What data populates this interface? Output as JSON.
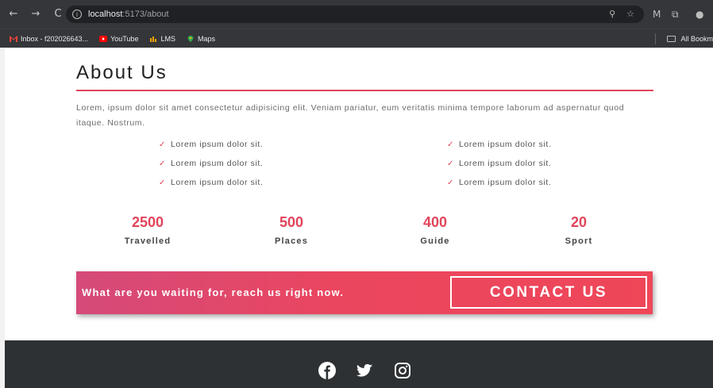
{
  "browser": {
    "nav_back": "←",
    "nav_forward": "→",
    "nav_reload": "C",
    "url_host": "localhost",
    "url_path": ":5173/about",
    "bookmarks": [
      {
        "label": "Inbox - f202026643...",
        "icon": "gmail-icon"
      },
      {
        "label": "YouTube",
        "icon": "youtube-icon"
      },
      {
        "label": "LMS",
        "icon": "lms-icon"
      },
      {
        "label": "Maps",
        "icon": "maps-icon"
      }
    ],
    "all_bookmarks": "All Bookm"
  },
  "about": {
    "title": "About Us",
    "intro": "Lorem, ipsum dolor sit amet consectetur adipisicing elit. Veniam pariatur, eum veritatis minima tempore laborum ad aspernatur quod itaque. Nostrum.",
    "check_left": [
      "Lorem ipsum dolor sit.",
      "Lorem ipsum dolor sit.",
      "Lorem ipsum dolor sit."
    ],
    "check_right": [
      "Lorem ipsum dolor sit.",
      "Lorem ipsum dolor sit.",
      "Lorem ipsum dolor sit."
    ],
    "check_glyph": "✓"
  },
  "stats": [
    {
      "value": "2500",
      "label": "Travelled"
    },
    {
      "value": "500",
      "label": "Places"
    },
    {
      "value": "400",
      "label": "Guide"
    },
    {
      "value": "20",
      "label": "Sport"
    }
  ],
  "cta": {
    "text": "What are you waiting for, reach us right now.",
    "button": "CONTACT US"
  },
  "footer": {
    "social": [
      "facebook-icon",
      "twitter-icon",
      "instagram-icon"
    ]
  },
  "colors": {
    "accent": "#e0455b",
    "footer_bg": "#2d3134",
    "cta_start": "#d54a7a",
    "cta_end": "#ef4658"
  }
}
